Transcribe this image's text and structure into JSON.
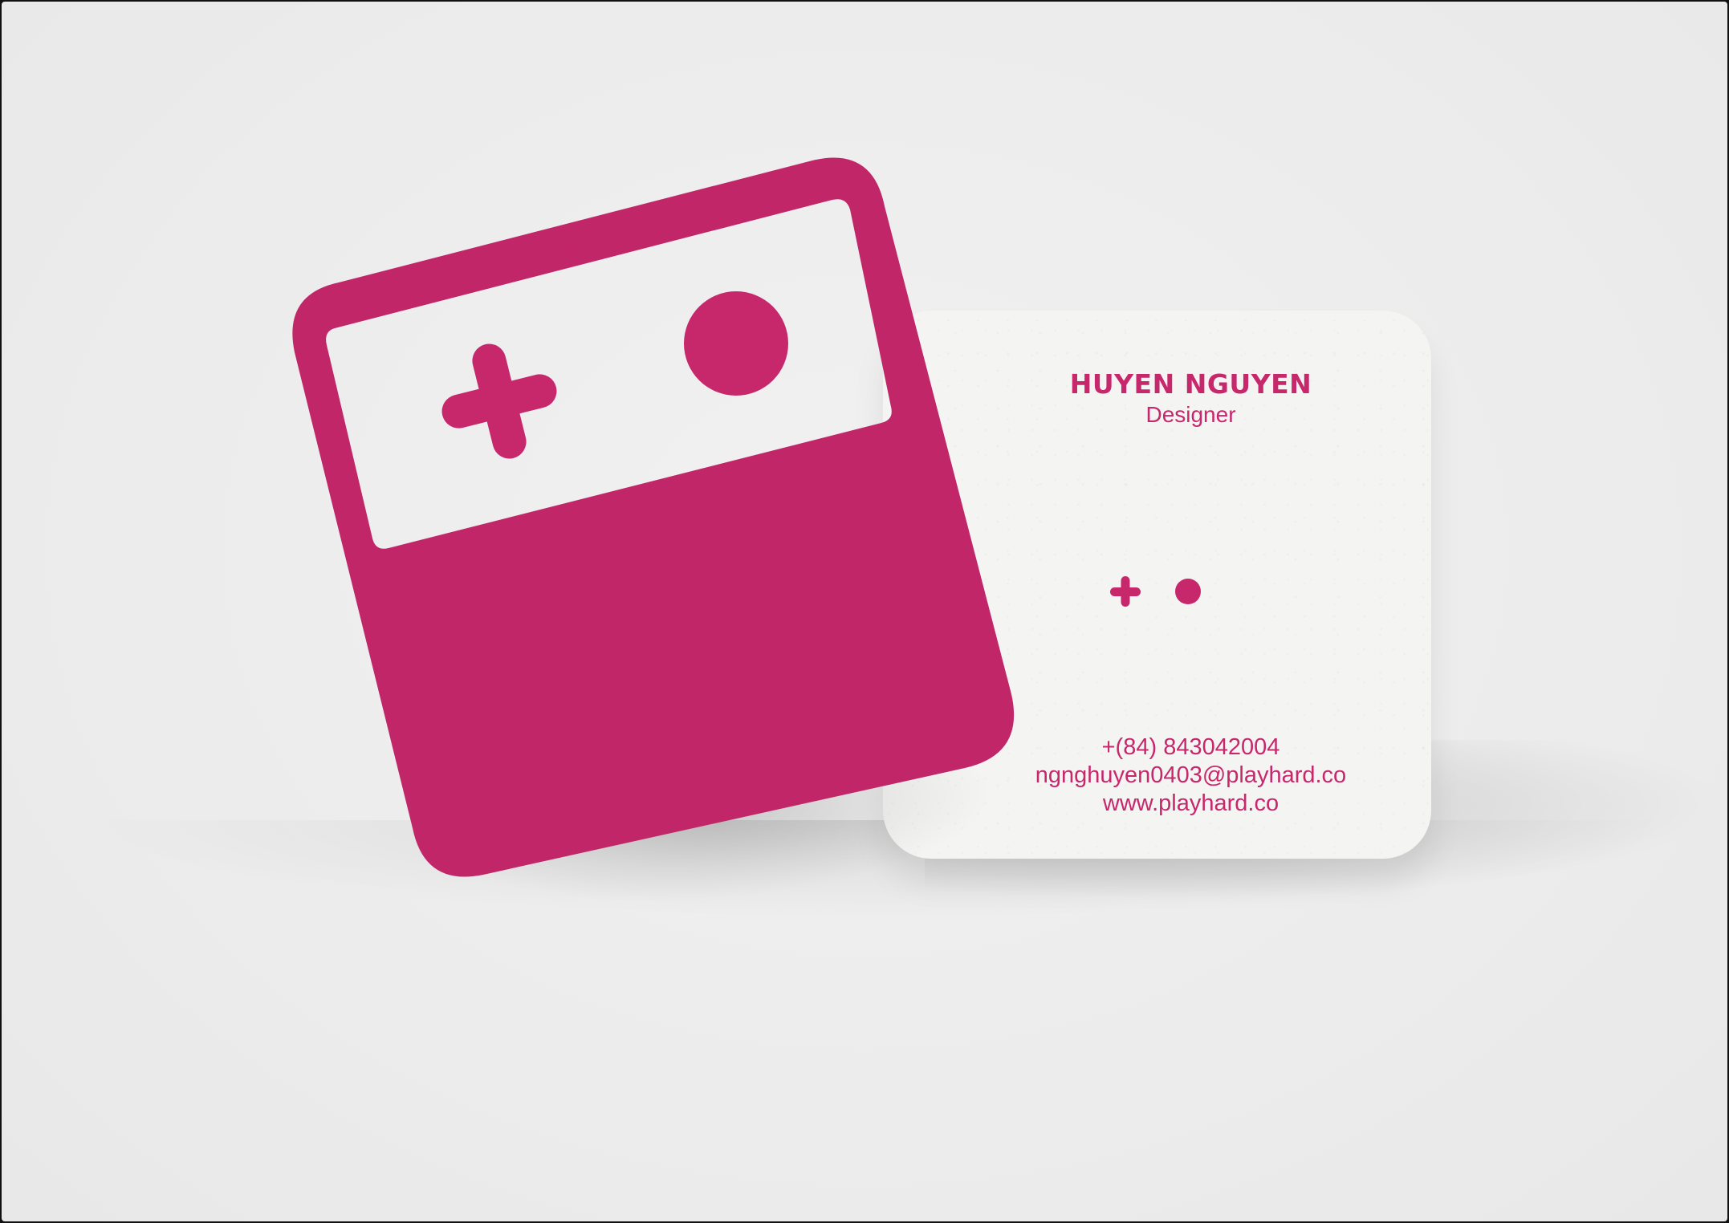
{
  "card": {
    "name": "HUYEN NGUYEN",
    "role": "Designer",
    "phone": "+(84) 843042004",
    "email": "ngnghuyen0403@playhard.co",
    "website": "www.playhard.co"
  },
  "brand": {
    "accent_color": "#c7286c",
    "paper_color": "#f4f4f3"
  },
  "icons": {
    "logo": "game-controller-icon",
    "dpad": "plus-icon",
    "button": "circle-icon"
  }
}
